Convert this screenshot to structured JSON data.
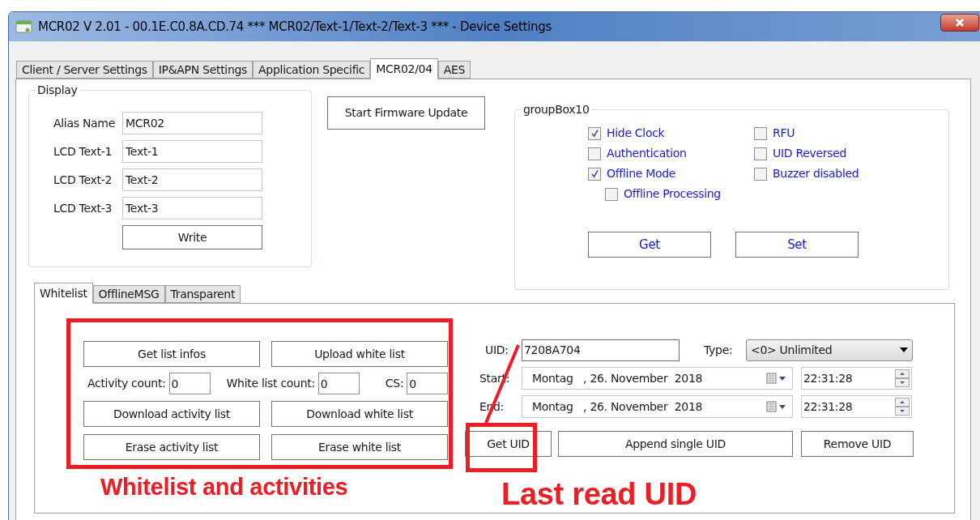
{
  "window": {
    "title": "MCR02 V 2.01 - 00.1E.C0.8A.CD.74 *** MCR02/Text-1/Text-2/Text-3 *** - Device Settings"
  },
  "tabs": [
    {
      "label": "Client / Server Settings",
      "selected": false
    },
    {
      "label": "IP&APN Settings",
      "selected": false
    },
    {
      "label": "Application Specific",
      "selected": false
    },
    {
      "label": "MCR02/04",
      "selected": true
    },
    {
      "label": "AES",
      "selected": false
    }
  ],
  "display": {
    "title": "Display",
    "fields": [
      {
        "label": "Alias Name",
        "value": "MCR02"
      },
      {
        "label": "LCD Text-1",
        "value": "Text-1"
      },
      {
        "label": "LCD Text-2",
        "value": "Text-2"
      },
      {
        "label": "LCD Text-3",
        "value": "Text-3"
      }
    ],
    "write_button": "Write"
  },
  "firmware_button": "Start Firmware Update",
  "group": {
    "title": "groupBox10",
    "columns": [
      [
        {
          "label": "Hide Clock",
          "checked": true
        },
        {
          "label": "Authentication",
          "checked": false
        },
        {
          "label": "Offline Mode",
          "checked": true,
          "children": [
            {
              "label": "Offline Processing",
              "checked": false
            }
          ]
        }
      ],
      [
        {
          "label": "RFU",
          "checked": false
        },
        {
          "label": "UID Reversed",
          "checked": false
        },
        {
          "label": "Buzzer disabled",
          "checked": false
        }
      ]
    ],
    "buttons": [
      "Get",
      "Set"
    ]
  },
  "sub_tabs": [
    {
      "label": "Whitelist",
      "selected": true
    },
    {
      "label": "OfflineMSG",
      "selected": false
    },
    {
      "label": "Transparent",
      "selected": false
    }
  ],
  "whitelist": {
    "top_buttons": [
      "Get list infos",
      "Upload white list"
    ],
    "counts": [
      {
        "label": "Activity count:",
        "value": "0"
      },
      {
        "label": "White list count:",
        "value": "0"
      },
      {
        "label": "CS:",
        "value": "0"
      }
    ],
    "download_buttons": [
      "Download activity list",
      "Download white list"
    ],
    "erase_buttons": [
      "Erase activity list",
      "Erase white list"
    ]
  },
  "uid": {
    "label": "UID:",
    "value": "7208A704"
  },
  "type": {
    "label": "Type:",
    "value": "<0> Unlimited"
  },
  "start": {
    "label": "Start:",
    "date": "Montag   , 26. November  2018",
    "time": "22:31:28"
  },
  "end": {
    "label": "End:",
    "date": "Montag   , 26. November  2018",
    "time": "22:31:28"
  },
  "uid_buttons": [
    "Get UID",
    "Append single UID",
    "Remove UID"
  ],
  "annotations": [
    "Whitelist and activities",
    "Last read UID"
  ]
}
